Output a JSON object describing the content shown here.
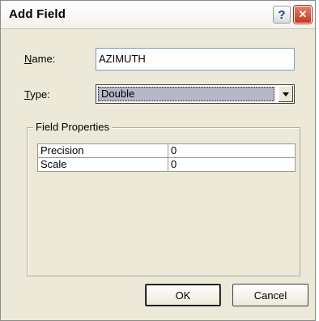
{
  "window": {
    "title": "Add Field",
    "help_glyph": "?",
    "close_glyph": "✕"
  },
  "form": {
    "name_label_accel": "N",
    "name_label_rest": "ame:",
    "name_value": "AZIMUTH",
    "type_label_accel": "T",
    "type_label_rest": "ype:",
    "type_value": "Double"
  },
  "field_properties": {
    "legend": "Field Properties",
    "rows": [
      {
        "key": "Precision",
        "value": "0"
      },
      {
        "key": "Scale",
        "value": "0"
      }
    ]
  },
  "buttons": {
    "ok": "OK",
    "cancel": "Cancel"
  },
  "icons": {
    "help": "help-icon",
    "close": "close-icon",
    "dropdown": "chevron-down-icon"
  },
  "colors": {
    "dialog_bg": "#ece9d8",
    "close_red": "#c4361a",
    "input_border": "#7f9db9",
    "selected_bg": "#b6b6c8"
  }
}
